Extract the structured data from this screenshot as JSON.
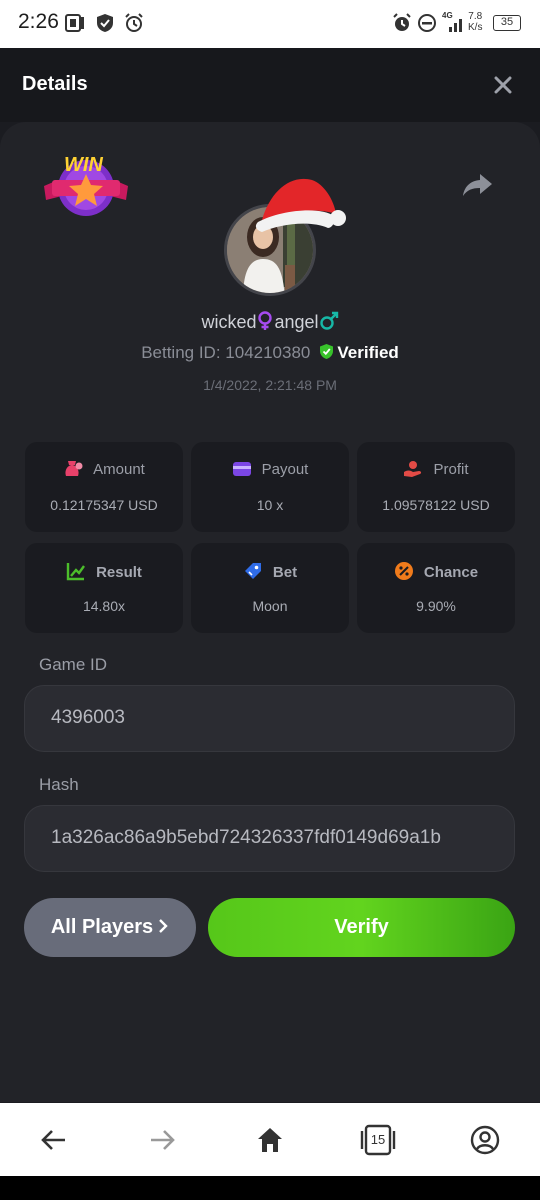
{
  "status_bar": {
    "time": "2:26",
    "network_speed_value": "7.8",
    "network_speed_unit": "K/s",
    "battery": "35",
    "network_type": "4G"
  },
  "header": {
    "title": "Details"
  },
  "badge": {
    "text": "WIN"
  },
  "player": {
    "name_part1": "wicked",
    "name_part2": "angel",
    "betting_id_label": "Betting ID: 104210380",
    "verified_label": "Verified",
    "timestamp": "1/4/2022, 2:21:48 PM"
  },
  "stats": [
    {
      "label": "Amount",
      "value": "0.12175347 USD",
      "icon": "money-bag-icon",
      "color": "#e8416a"
    },
    {
      "label": "Payout",
      "value": "10 x",
      "icon": "wallet-icon",
      "color": "#7b46e4"
    },
    {
      "label": "Profit",
      "value": "1.09578122 USD",
      "icon": "hand-coin-icon",
      "color": "#e34b46"
    },
    {
      "label": "Result",
      "value": "14.80x",
      "icon": "chart-up-icon",
      "color": "#4cbe2b"
    },
    {
      "label": "Bet",
      "value": "Moon",
      "icon": "tag-icon",
      "color": "#2f6ce8"
    },
    {
      "label": "Chance",
      "value": "9.90%",
      "icon": "percent-icon",
      "color": "#f07b1b"
    }
  ],
  "game_id": {
    "label": "Game ID",
    "value": "4396003"
  },
  "hash": {
    "label": "Hash",
    "value": "1a326ac86a9b5ebd724326337fdf0149d69a1b"
  },
  "buttons": {
    "all_players": "All Players",
    "verify": "Verify"
  },
  "nav": {
    "tab_count": "15"
  },
  "colors": {
    "accent_green": "#5ccd1c",
    "background": "#1b1c21",
    "card": "#222328"
  }
}
